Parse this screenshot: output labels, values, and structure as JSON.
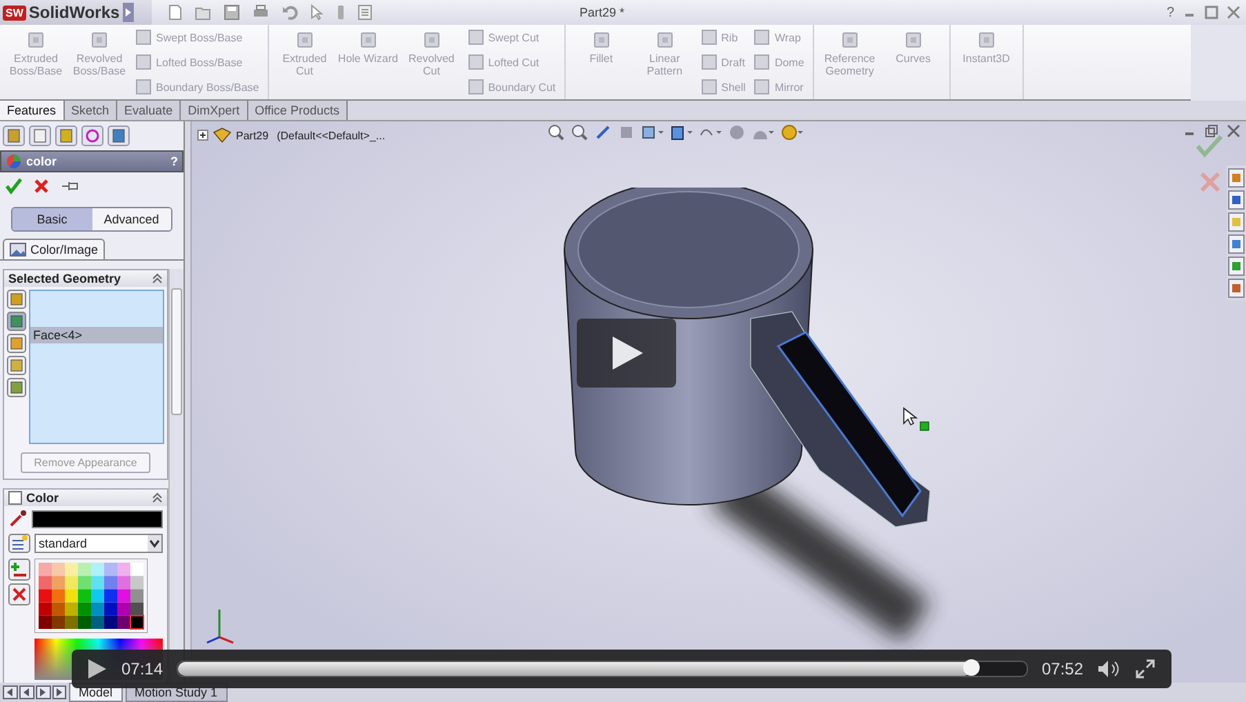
{
  "app": {
    "logo_badge": "SW",
    "logo": "SolidWorks",
    "document_title": "Part29 *",
    "help_glyph": "?"
  },
  "ribbon": {
    "groups": [
      {
        "items": [
          {
            "kind": "large",
            "label": "Extruded Boss/Base"
          },
          {
            "kind": "large",
            "label": "Revolved Boss/Base"
          },
          {
            "kind": "stack",
            "items": [
              "Swept Boss/Base",
              "Lofted Boss/Base",
              "Boundary Boss/Base"
            ]
          }
        ]
      },
      {
        "items": [
          {
            "kind": "large",
            "label": "Extruded Cut"
          },
          {
            "kind": "large",
            "label": "Hole Wizard"
          },
          {
            "kind": "large",
            "label": "Revolved Cut"
          },
          {
            "kind": "stack",
            "items": [
              "Swept Cut",
              "Lofted Cut",
              "Boundary Cut"
            ]
          }
        ]
      },
      {
        "items": [
          {
            "kind": "large",
            "label": "Fillet"
          },
          {
            "kind": "large",
            "label": "Linear Pattern"
          },
          {
            "kind": "stack",
            "items": [
              "Rib",
              "Draft",
              "Shell"
            ]
          },
          {
            "kind": "stack",
            "items": [
              "Wrap",
              "Dome",
              "Mirror"
            ]
          }
        ]
      },
      {
        "items": [
          {
            "kind": "large",
            "label": "Reference Geometry"
          },
          {
            "kind": "large",
            "label": "Curves"
          }
        ]
      },
      {
        "items": [
          {
            "kind": "large",
            "label": "Instant3D"
          }
        ]
      }
    ]
  },
  "tabs": [
    {
      "label": "Features",
      "selected": true
    },
    {
      "label": "Sketch",
      "selected": false
    },
    {
      "label": "Evaluate",
      "selected": false
    },
    {
      "label": "DimXpert",
      "selected": false
    },
    {
      "label": "Office Products",
      "selected": false
    }
  ],
  "property_manager": {
    "title": "color",
    "help": "?",
    "modes": [
      {
        "label": "Basic",
        "selected": true
      },
      {
        "label": "Advanced",
        "selected": false
      }
    ],
    "tab": "Color/Image",
    "selected_geometry": {
      "title": "Selected Geometry",
      "items": [
        {
          "label": "Face<4>",
          "selected": true
        }
      ],
      "button": "Remove Appearance"
    },
    "color": {
      "title": "Color",
      "checked": false,
      "dropdown": "standard"
    }
  },
  "tree": {
    "part": "Part29",
    "configuration": "(Default<<Default>_..."
  },
  "video": {
    "current": "07:14",
    "duration": "07:52",
    "level": 0.935
  },
  "bottom_tabs": [
    {
      "label": "Model",
      "selected": true
    },
    {
      "label": "Motion Study 1",
      "selected": false
    }
  ]
}
